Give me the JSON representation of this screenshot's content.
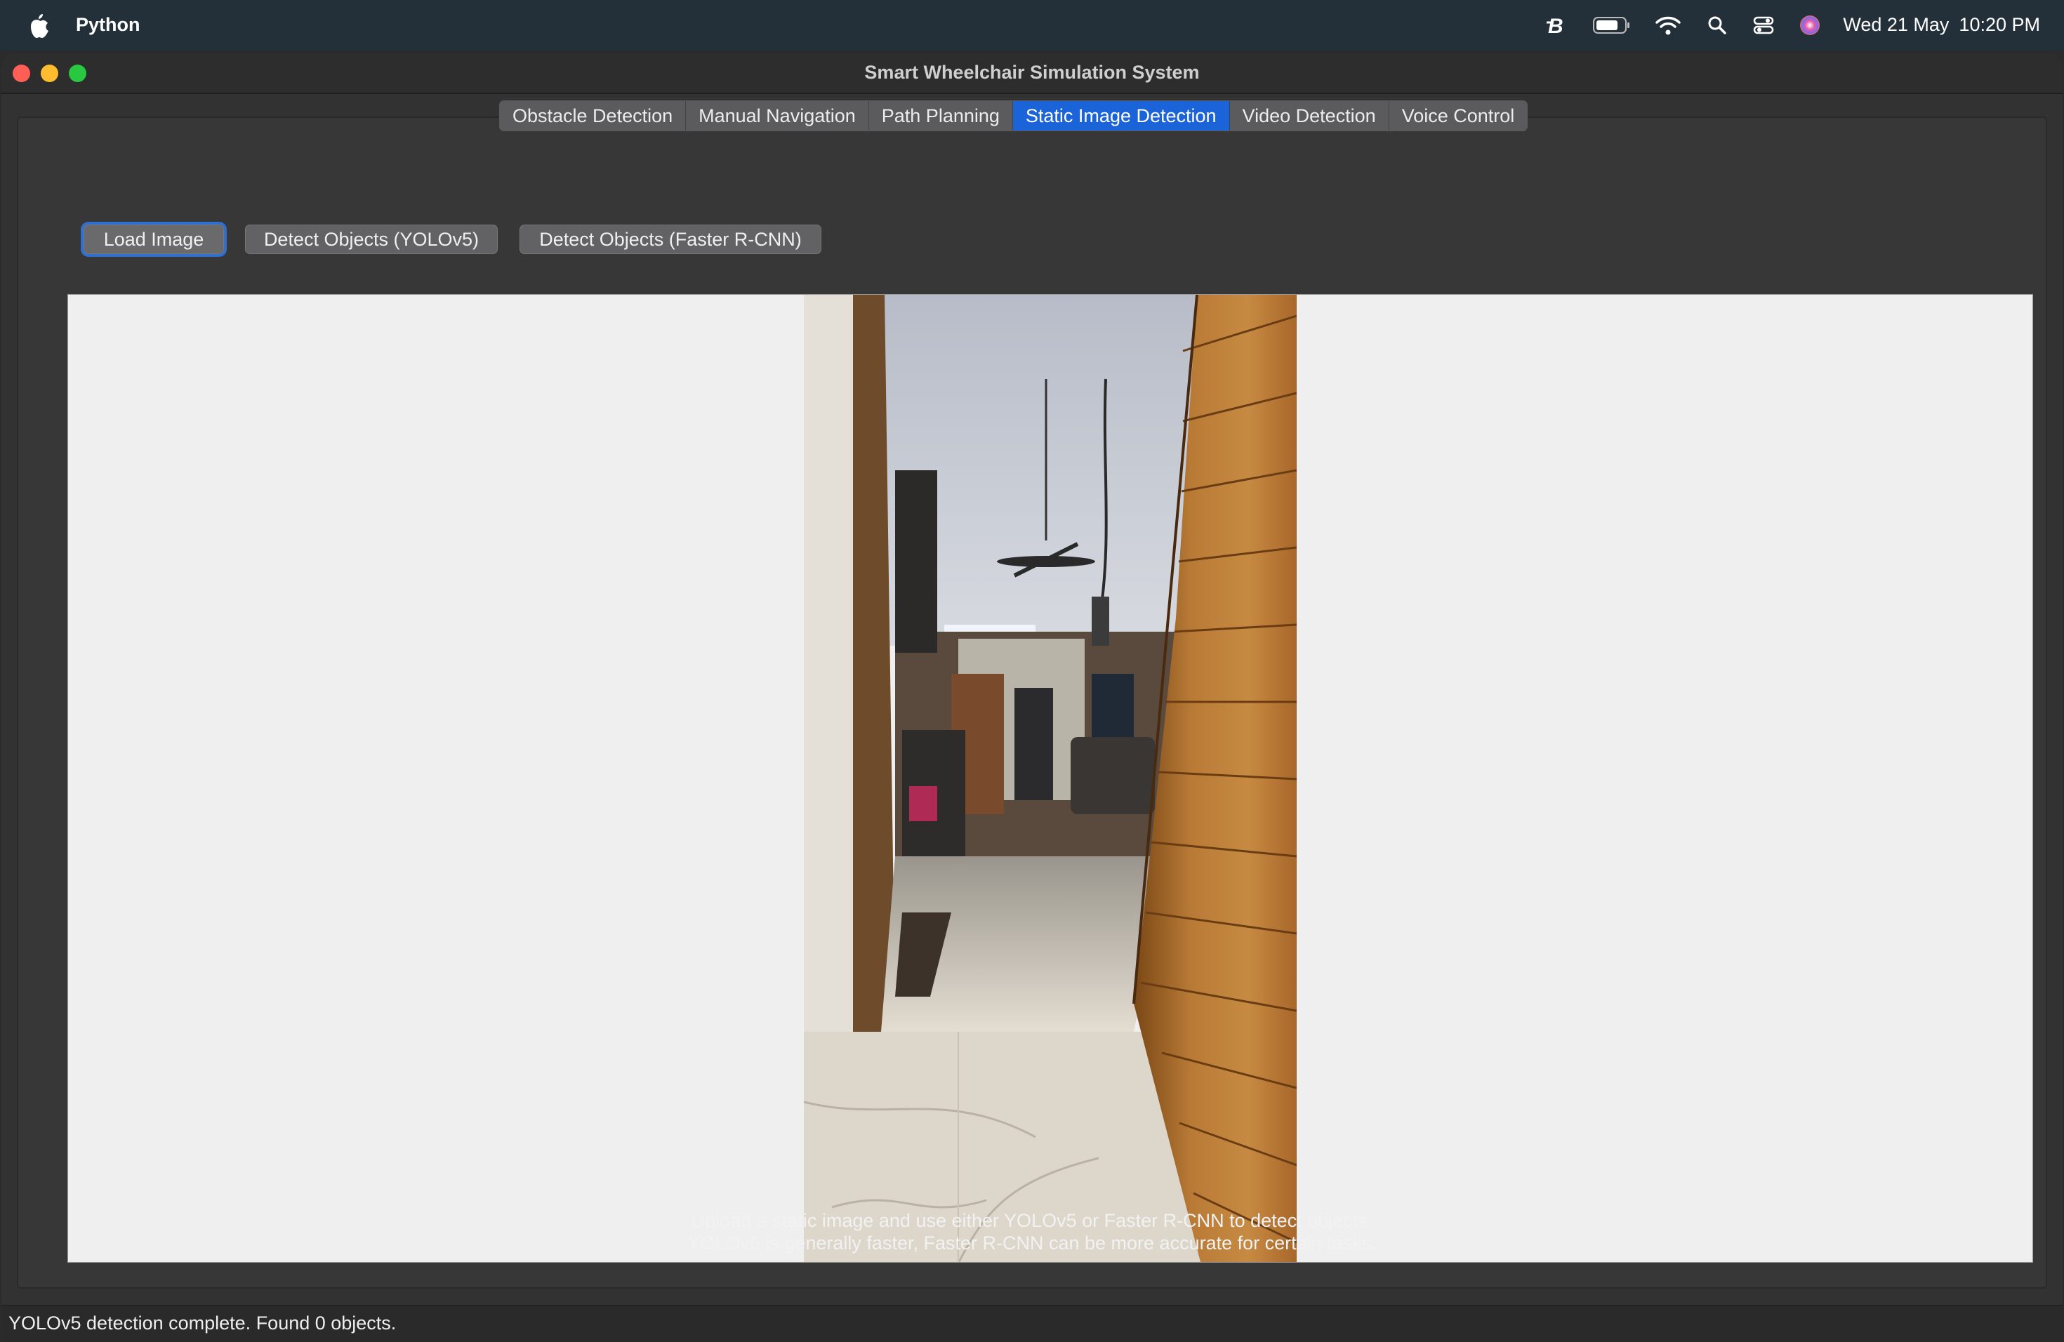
{
  "menubar": {
    "app_name": "Python",
    "date": "Wed 21 May",
    "time": "10:20 PM",
    "icons": [
      "apple-icon",
      "b-icon",
      "battery-icon",
      "wifi-icon",
      "search-icon",
      "control-center-icon",
      "siri-icon"
    ]
  },
  "window": {
    "title": "Smart Wheelchair Simulation System"
  },
  "tabs": [
    {
      "label": "Obstacle Detection",
      "active": false
    },
    {
      "label": "Manual Navigation",
      "active": false
    },
    {
      "label": "Path Planning",
      "active": false
    },
    {
      "label": "Static Image Detection",
      "active": true
    },
    {
      "label": "Video Detection",
      "active": false
    },
    {
      "label": "Voice Control",
      "active": false
    }
  ],
  "toolbar": {
    "load_label": "Load Image",
    "yolo_label": "Detect Objects (YOLOv5)",
    "rcnn_label": "Detect Objects (Faster R-CNN)"
  },
  "hint": {
    "line1": "Upload a static image and use either YOLOv5 or Faster R-CNN to detect objects.",
    "line2": "YOLOv5 is generally faster, Faster R-CNN can be more accurate for certain tasks."
  },
  "status": {
    "text": "YOLOv5 detection complete. Found 0 objects."
  },
  "colors": {
    "accent": "#1a63d8",
    "menubar": "#243039",
    "window": "#323232"
  }
}
